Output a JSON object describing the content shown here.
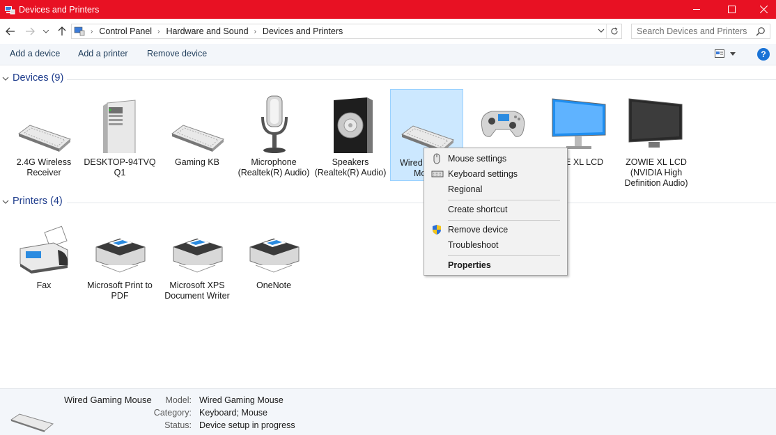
{
  "window": {
    "title": "Devices and Printers"
  },
  "nav": {
    "breadcrumbs": [
      "Control Panel",
      "Hardware and Sound",
      "Devices and Printers"
    ],
    "search_placeholder": "Search Devices and Printers"
  },
  "commands": [
    "Add a device",
    "Add a printer",
    "Remove device"
  ],
  "sections": {
    "devices": {
      "title": "Devices (9)",
      "items": [
        {
          "label": "2.4G Wireless Receiver",
          "icon": "keyboard-icon"
        },
        {
          "label": "DESKTOP-94TVQ Q1",
          "icon": "computer-tower-icon"
        },
        {
          "label": "Gaming KB",
          "icon": "keyboard-icon"
        },
        {
          "label": "Microphone (Realtek(R) Audio)",
          "icon": "microphone-icon"
        },
        {
          "label": "Speakers (Realtek(R) Audio)",
          "icon": "speaker-icon"
        },
        {
          "label": "Wired Gaming Mouse",
          "icon": "keyboard-icon",
          "selected": true
        },
        {
          "label": "",
          "icon": "gamepad-icon"
        },
        {
          "label": "ZOWIE XL LCD",
          "icon": "monitor-icon"
        },
        {
          "label": "ZOWIE XL LCD (NVIDIA High Definition Audio)",
          "icon": "monitor-icon"
        }
      ]
    },
    "printers": {
      "title": "Printers (4)",
      "items": [
        {
          "label": "Fax",
          "icon": "fax-icon"
        },
        {
          "label": "Microsoft Print to PDF",
          "icon": "printer-icon"
        },
        {
          "label": "Microsoft XPS Document Writer",
          "icon": "printer-icon"
        },
        {
          "label": "OneNote",
          "icon": "printer-icon"
        }
      ]
    }
  },
  "selected_tile_visible_text": {
    "line1": "Wired",
    "line2": "Mo"
  },
  "obscured_tile_visible_text": "WIE XL LCD",
  "context_menu": {
    "items": [
      {
        "label": "Mouse settings",
        "icon": "mouse-icon"
      },
      {
        "label": "Keyboard settings",
        "icon": "keyboard-small-icon"
      },
      {
        "label": "Regional",
        "icon": ""
      },
      {
        "label": "Create shortcut",
        "icon": ""
      },
      {
        "label": "Remove device",
        "icon": "uac-shield-icon"
      },
      {
        "label": "Troubleshoot",
        "icon": ""
      },
      {
        "label": "Properties",
        "icon": "",
        "bold": true
      }
    ]
  },
  "details": {
    "name": "Wired Gaming Mouse",
    "model_label": "Model:",
    "model": "Wired Gaming Mouse",
    "category_label": "Category:",
    "category": "Keyboard; Mouse",
    "status_label": "Status:",
    "status": "Device setup in progress"
  },
  "colors": {
    "titlebar": "#e81123",
    "selection": "#cce8ff",
    "section_title": "#1e3c8c",
    "help": "#1a73d6"
  }
}
